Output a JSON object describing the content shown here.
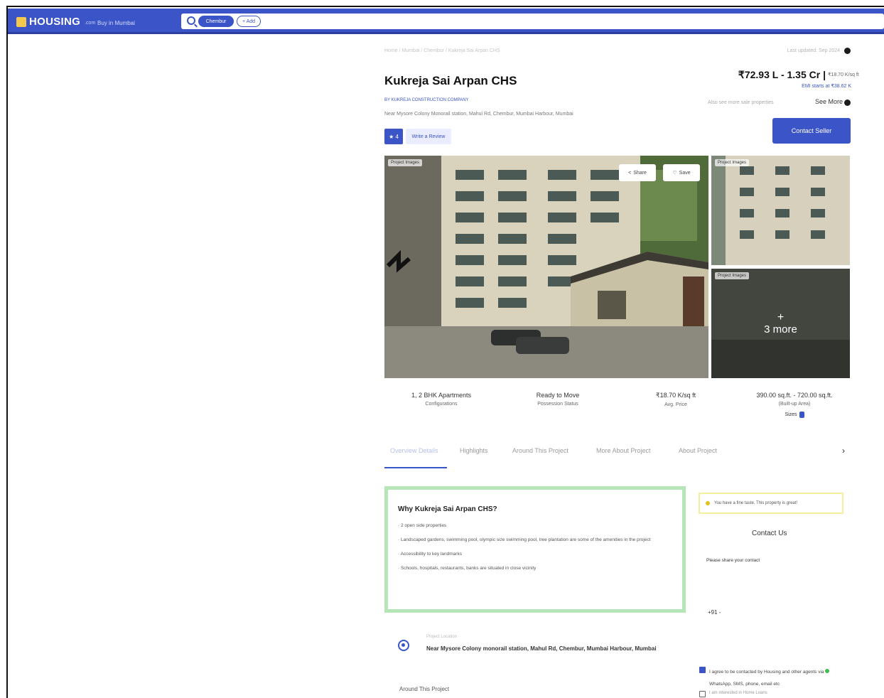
{
  "navbar": {
    "logo_text": "HOUSING",
    "logo_sub": ".com",
    "city": "Buy in Mumbai",
    "chip_locality": "Chembur",
    "chip_add": "+ Add"
  },
  "header": {
    "breadcrumb": "Home / Mumbai / Chembur / Kukreja Sai Arpan CHS",
    "updated": "Last updated: Sep 2024",
    "title": "Kukreja Sai Arpan CHS",
    "price": "₹72.93 L - 1.35 Cr |",
    "price_sqft": "₹18.70 K/sq ft",
    "emi": "EMI starts at ₹38.62 K",
    "developer": "BY KUKREJA CONSTRUCTION COMPANY",
    "address": "Near Mysore Colony Monorail station, Mahul Rd, Chembur, Mumbai Harbour, Mumbai",
    "see_more_lead": "Also see more sale properties",
    "see_more": "See More",
    "rating": "★ 4",
    "review": "Write a Review",
    "contact_seller": "Contact Seller"
  },
  "photos": {
    "tag": "Project Images",
    "share": "Share",
    "save": "Save",
    "more_plus": "+",
    "more_text": "3 more"
  },
  "stats": [
    {
      "value": "1, 2 BHK Apartments",
      "label": "Configurations"
    },
    {
      "value": "Ready to Move",
      "label": "Possession Status"
    },
    {
      "value": "₹18.70 K/sq ft",
      "label": "Avg. Price"
    },
    {
      "value": "390.00 sq.ft. - 720.00 sq.ft.",
      "label": "(Built-up Area)",
      "extra": "Sizes"
    }
  ],
  "tabs": [
    "Overview Details",
    "Highlights",
    "Around This Project",
    "More About Project",
    "About Project"
  ],
  "why": {
    "title": "Why Kukreja Sai Arpan CHS?",
    "points": [
      "2 open side properties",
      "Landscaped gardens, swimming pool, olympic size swimming pool, tree plantation are some of the amenities in the project",
      "Accessibility to key landmarks",
      "Schools, hospitals, restaurants, banks are situated in close vicinity"
    ]
  },
  "location": {
    "label": "Project Location",
    "address": "Near Mysore Colony monorail station, Mahul Rd, Chembur, Mumbai Harbour, Mumbai",
    "around": "Around This Project"
  },
  "sidebar": {
    "notice": "You have a fine taste. This property is great!",
    "contact_title": "Contact Us",
    "share_contact": "Please share your contact",
    "contact_misc": "+91 -",
    "agree_text_a": "I agree to be contacted by Housing and other agents via",
    "agree_text_b": "WhatsApp, SMS, phone, email etc",
    "interest": "I am interested in Home Loans"
  },
  "colors": {
    "brand": "#3b54c8",
    "highlight_border": "#b6e6b8",
    "notice_border": "#f5ef9c"
  }
}
